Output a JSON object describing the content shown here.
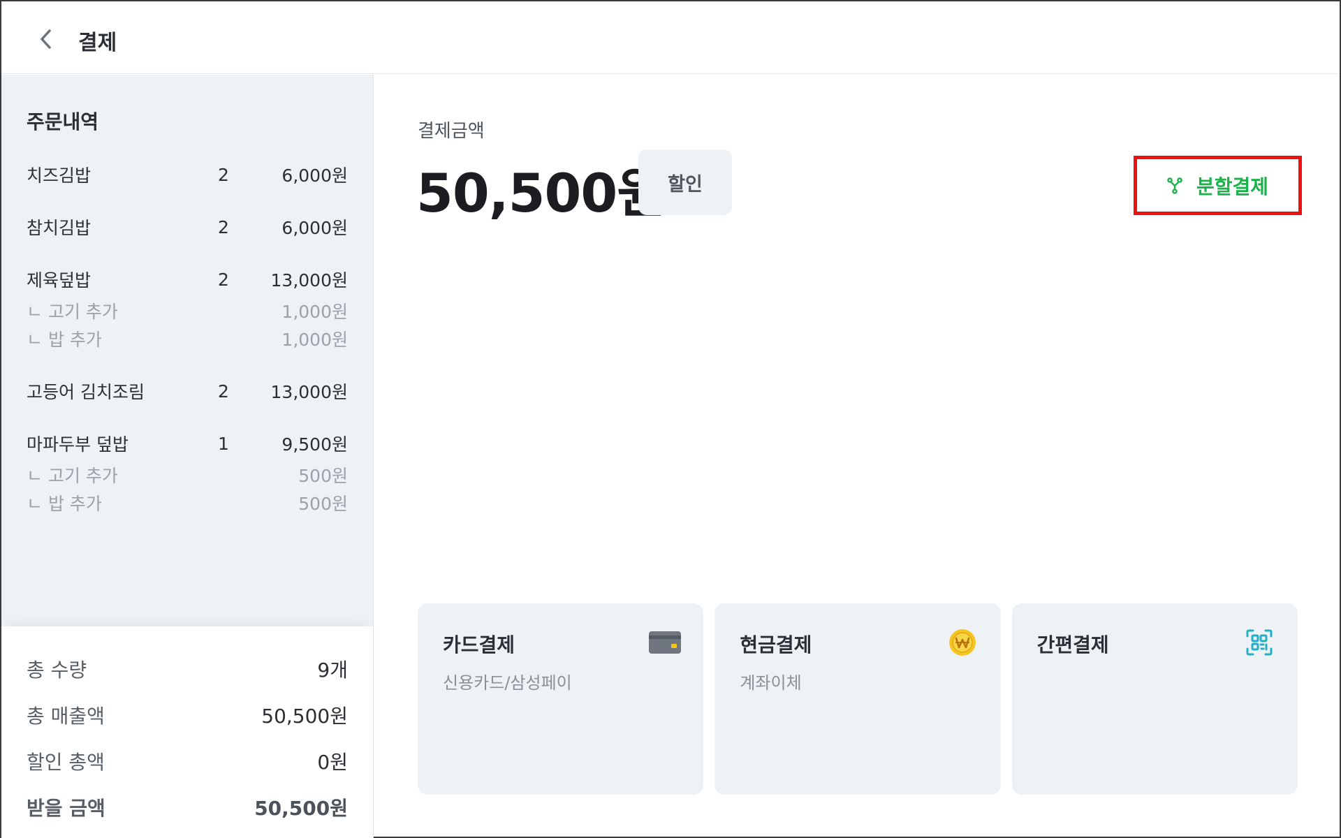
{
  "header": {
    "title": "결제",
    "back_icon": "chevron-left-icon"
  },
  "sidebar": {
    "title": "주문내역",
    "items": [
      {
        "name": "치즈김밥",
        "qty": "2",
        "price": "6,000원",
        "options": []
      },
      {
        "name": "참치김밥",
        "qty": "2",
        "price": "6,000원",
        "options": []
      },
      {
        "name": "제육덮밥",
        "qty": "2",
        "price": "13,000원",
        "options": [
          {
            "name": "ㄴ 고기 추가",
            "price": "1,000원"
          },
          {
            "name": "ㄴ 밥 추가",
            "price": "1,000원"
          }
        ]
      },
      {
        "name": "고등어 김치조림",
        "qty": "2",
        "price": "13,000원",
        "options": []
      },
      {
        "name": "마파두부 덮밥",
        "qty": "1",
        "price": "9,500원",
        "options": [
          {
            "name": "ㄴ 고기 추가",
            "price": "500원"
          },
          {
            "name": "ㄴ 밥 추가",
            "price": "500원"
          }
        ]
      }
    ]
  },
  "summary": {
    "total_qty_label": "총 수량",
    "total_qty": "9개",
    "total_sales_label": "총 매출액",
    "total_sales": "50,500원",
    "discount_label": "할인 총액",
    "discount": "0원",
    "receivable_label": "받을 금액",
    "receivable": "50,500원"
  },
  "main": {
    "amount_label": "결제금액",
    "amount": "50,500원",
    "discount_button": "할인",
    "split_button": "분할결제",
    "split_icon": "split-icon",
    "accent_color": "#1ab34a",
    "highlight_color": "#ee1111"
  },
  "payment_methods": [
    {
      "title": "카드결제",
      "subtitle": "신용카드/삼성페이",
      "icon": "credit-card-icon"
    },
    {
      "title": "현금결제",
      "subtitle": "계좌이체",
      "icon": "won-coin-icon"
    },
    {
      "title": "간편결제",
      "subtitle": "",
      "icon": "qr-scan-icon"
    }
  ]
}
